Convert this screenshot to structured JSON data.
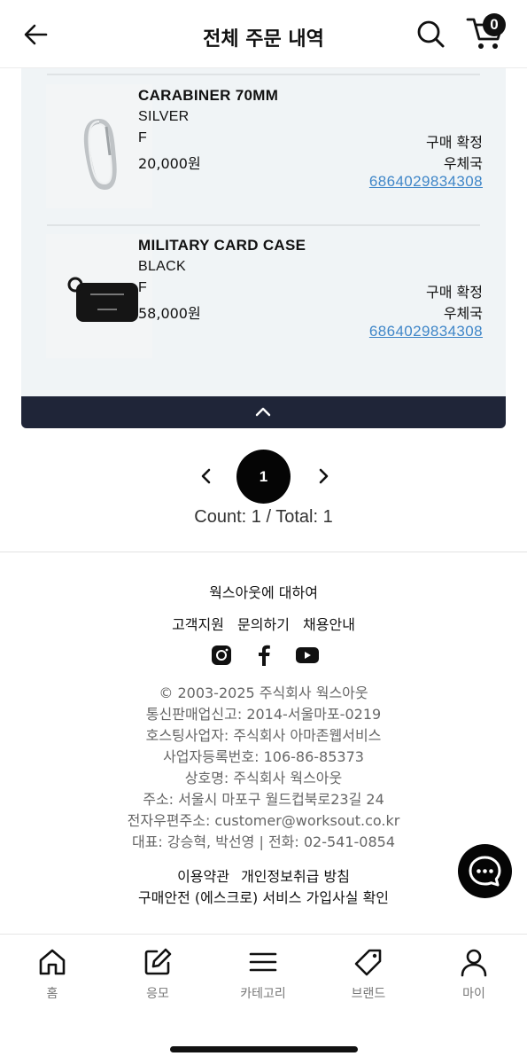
{
  "header": {
    "title": "전체 주문 내역",
    "cart_count": "0"
  },
  "orders": [
    {
      "name": "CARABINER 70MM",
      "color": "SILVER",
      "size": "F",
      "price": "20,000원",
      "status": "구매 확정",
      "courier": "우체국",
      "tracking": "6864029834308"
    },
    {
      "name": "MILITARY CARD CASE",
      "color": "BLACK",
      "size": "F",
      "price": "58,000원",
      "status": "구매 확정",
      "courier": "우체국",
      "tracking": "6864029834308"
    }
  ],
  "pagination": {
    "current_page": "1",
    "count_text": "Count: 1 / Total: 1"
  },
  "footer": {
    "about": "웍스아웃에 대하여",
    "links": [
      "고객지원",
      "문의하기",
      "채용안내"
    ],
    "info_lines": [
      "© 2003-2025 주식회사 웍스아웃",
      "통신판매업신고: 2014-서울마포-0219",
      "호스팅사업자: 주식회사 아마존웹서비스",
      "사업자등록번호: 106-86-85373",
      "상호명: 주식회사 웍스아웃",
      "주소: 서울시 마포구 월드컵북로23길 24",
      "전자우편주소: customer@worksout.co.kr",
      "대표: 강승혁, 박선영 | 전화: 02-541-0854"
    ],
    "policy_links": [
      "이용약관",
      "개인정보취급 방침"
    ],
    "escrow": "구매안전 (에스크로) 서비스 가입사실 확인"
  },
  "bottom_nav": [
    {
      "label": "홈",
      "icon": "home-icon"
    },
    {
      "label": "응모",
      "icon": "edit-icon"
    },
    {
      "label": "카테고리",
      "icon": "menu-icon"
    },
    {
      "label": "브랜드",
      "icon": "tag-icon"
    },
    {
      "label": "마이",
      "icon": "user-icon"
    }
  ],
  "colors": {
    "tracking_link": "#3f86c8",
    "panel_bg": "#f0f4f6",
    "collapse_bar": "#1f2538"
  }
}
